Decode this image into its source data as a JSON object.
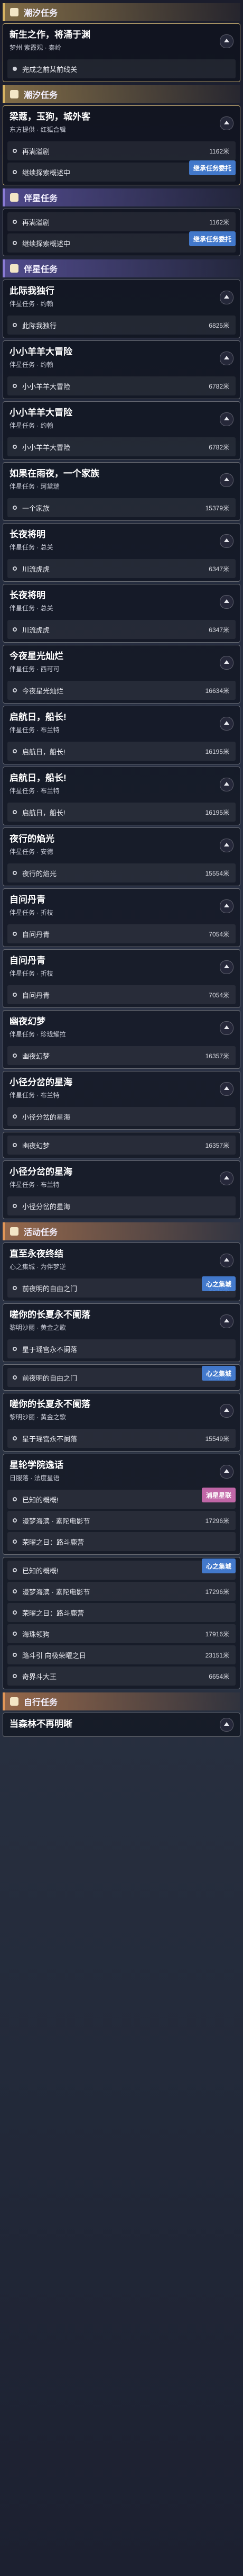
{
  "sections": [
    {
      "type": "header",
      "style": "gold",
      "icon": "wave-icon",
      "title": "潮汐任务"
    },
    {
      "type": "card",
      "gold": true,
      "title": "新生之作，将涌于渊",
      "subtitle": "梦州 紫霞观 · 秦岭",
      "rows": [
        {
          "label": "完成之前某前线关",
          "dist": "",
          "bullet": "fill"
        }
      ]
    },
    {
      "type": "header",
      "style": "gold",
      "icon": "wave-icon",
      "title": "潮汐任务"
    },
    {
      "type": "card",
      "gold": true,
      "title": "梁蔻，玉狗，城外客",
      "subtitle": "东方提供 · 红狐合辑",
      "rows": [
        {
          "label": "再满溢剧",
          "dist": "1162米"
        },
        {
          "label": "继续探索概述中",
          "dist": "",
          "badge": "继承任务委托",
          "badgeStyle": "blue"
        }
      ]
    },
    {
      "type": "header",
      "style": "purple",
      "icon": "dot-icon",
      "title": "伴星任务"
    },
    {
      "type": "card",
      "title": "",
      "subtitle": "",
      "rows": [
        {
          "label": "再满溢剧",
          "dist": "1162米"
        },
        {
          "label": "继续探索概述中",
          "dist": "",
          "badge": "继承任务委托",
          "badgeStyle": "blue"
        }
      ]
    },
    {
      "type": "header",
      "style": "purple",
      "icon": "dot-icon",
      "title": "伴星任务"
    },
    {
      "type": "card",
      "title": "此际我独行",
      "subtitle": "伴星任务 · 约翰",
      "rows": [
        {
          "label": "此际我独行",
          "dist": "6825米"
        }
      ]
    },
    {
      "type": "card",
      "title": "小小羊羊大冒险",
      "subtitle": "伴星任务 · 约翰",
      "rows": [
        {
          "label": "小小羊羊大冒险",
          "dist": "6782米"
        }
      ]
    },
    {
      "type": "card",
      "title": "小小羊羊大冒险",
      "subtitle": "伴星任务 · 约翰",
      "rows": [
        {
          "label": "小小羊羊大冒险",
          "dist": "6782米"
        }
      ]
    },
    {
      "type": "card",
      "title": "如果在雨夜，一个家族",
      "subtitle": "伴星任务 · 珂黛瑞",
      "rows": [
        {
          "label": "一个家族",
          "dist": "15379米"
        }
      ]
    },
    {
      "type": "card",
      "title": "长夜将明",
      "subtitle": "伴星任务 · 总关",
      "rows": [
        {
          "label": "川流虎虎",
          "dist": "6347米"
        }
      ]
    },
    {
      "type": "card",
      "title": "长夜将明",
      "subtitle": "伴星任务 · 总关",
      "rows": [
        {
          "label": "川流虎虎",
          "dist": "6347米"
        }
      ]
    },
    {
      "type": "card",
      "title": "今夜星光灿烂",
      "subtitle": "伴星任务 · 西可可",
      "rows": [
        {
          "label": "今夜星光灿烂",
          "dist": "16634米"
        }
      ]
    },
    {
      "type": "card",
      "title": "启航日，船长!",
      "subtitle": "伴星任务 · 布兰特",
      "rows": [
        {
          "label": "启航日，船长!",
          "dist": "16195米"
        }
      ]
    },
    {
      "type": "card",
      "title": "启航日，船长!",
      "subtitle": "伴星任务 · 布兰特",
      "rows": [
        {
          "label": "启航日，船长!",
          "dist": "16195米"
        }
      ]
    },
    {
      "type": "card",
      "title": "夜行的焰光",
      "subtitle": "伴星任务 · 安德",
      "rows": [
        {
          "label": "夜行的焰光",
          "dist": "15554米"
        }
      ]
    },
    {
      "type": "card",
      "title": "自问丹青",
      "subtitle": "伴星任务 · 折枝",
      "rows": [
        {
          "label": "自问丹青",
          "dist": "7054米"
        }
      ]
    },
    {
      "type": "card",
      "title": "自问丹青",
      "subtitle": "伴星任务 · 折枝",
      "rows": [
        {
          "label": "自问丹青",
          "dist": "7054米"
        }
      ]
    },
    {
      "type": "card",
      "title": "幽夜幻梦",
      "subtitle": "伴星任务 · 珍珑耀拉",
      "rows": [
        {
          "label": "幽夜幻梦",
          "dist": "16357米"
        }
      ]
    },
    {
      "type": "card",
      "title": "小径分岔的星海",
      "subtitle": "伴星任务 · 布兰特",
      "rows": [
        {
          "label": "小径分岔的星海",
          "dist": ""
        }
      ]
    },
    {
      "type": "card",
      "title": "",
      "subtitle": "",
      "rows": [
        {
          "label": "幽夜幻梦",
          "dist": "16357米"
        }
      ]
    },
    {
      "type": "card",
      "title": "小径分岔的星海",
      "subtitle": "伴星任务 · 布兰特",
      "rows": [
        {
          "label": "小径分岔的星海",
          "dist": ""
        }
      ]
    },
    {
      "type": "header",
      "style": "orange",
      "icon": "star-icon",
      "title": "活动任务"
    },
    {
      "type": "card",
      "title": "直至永夜终结",
      "subtitle": "心之集城 · 为伴梦逆",
      "rows": [
        {
          "label": "前夜明的自由之门",
          "dist": "5349米",
          "badge": "心之集城",
          "badgeStyle": "blue"
        }
      ]
    },
    {
      "type": "card",
      "title": "嗟你的长夏永不阑落",
      "subtitle": "黎明沙丽 · 黄金之歌",
      "rows": [
        {
          "label": "星于瑶宫永不阑落",
          "dist": ""
        }
      ]
    },
    {
      "type": "card",
      "title": "",
      "subtitle": "",
      "rows": [
        {
          "label": "前夜明的自由之门",
          "dist": "5349米",
          "badge": "心之集城",
          "badgeStyle": "blue"
        }
      ]
    },
    {
      "type": "card",
      "title": "嗟你的长夏永不阑落",
      "subtitle": "黎明沙丽 · 黄金之歌",
      "rows": [
        {
          "label": "星于瑶宫永不阑落",
          "dist": "15549米"
        }
      ]
    },
    {
      "type": "card",
      "title": "星轮学院逸话",
      "subtitle": "日服落 · 法度星语",
      "rows": [
        {
          "label": "已知的概概!",
          "dist": "",
          "badge": "浦星星联",
          "badgeStyle": "pink"
        },
        {
          "label": "漫梦海滨 · 素陀电影节",
          "dist": "17296米"
        },
        {
          "label": "荣曜之日：路斗鹿营",
          "dist": ""
        }
      ]
    },
    {
      "type": "card",
      "title": "",
      "subtitle": "",
      "rows": [
        {
          "label": "已知的概概!",
          "dist": "",
          "badge": "心之集城",
          "badgeStyle": "blue"
        },
        {
          "label": "漫梦海滨 · 素陀电影节",
          "dist": "17296米"
        },
        {
          "label": "荣曜之日：路斗鹿营",
          "dist": ""
        },
        {
          "label": "海珠领狗",
          "dist": "17916米"
        },
        {
          "label": "路斗引 向极荣曜之日",
          "dist": "23151米"
        },
        {
          "label": "奇界斗大王",
          "dist": "6654米"
        }
      ]
    },
    {
      "type": "header",
      "style": "orange",
      "icon": "flag-icon",
      "title": "自行任务"
    },
    {
      "type": "card",
      "title": "当森林不再明晰",
      "subtitle": "",
      "rows": []
    }
  ]
}
